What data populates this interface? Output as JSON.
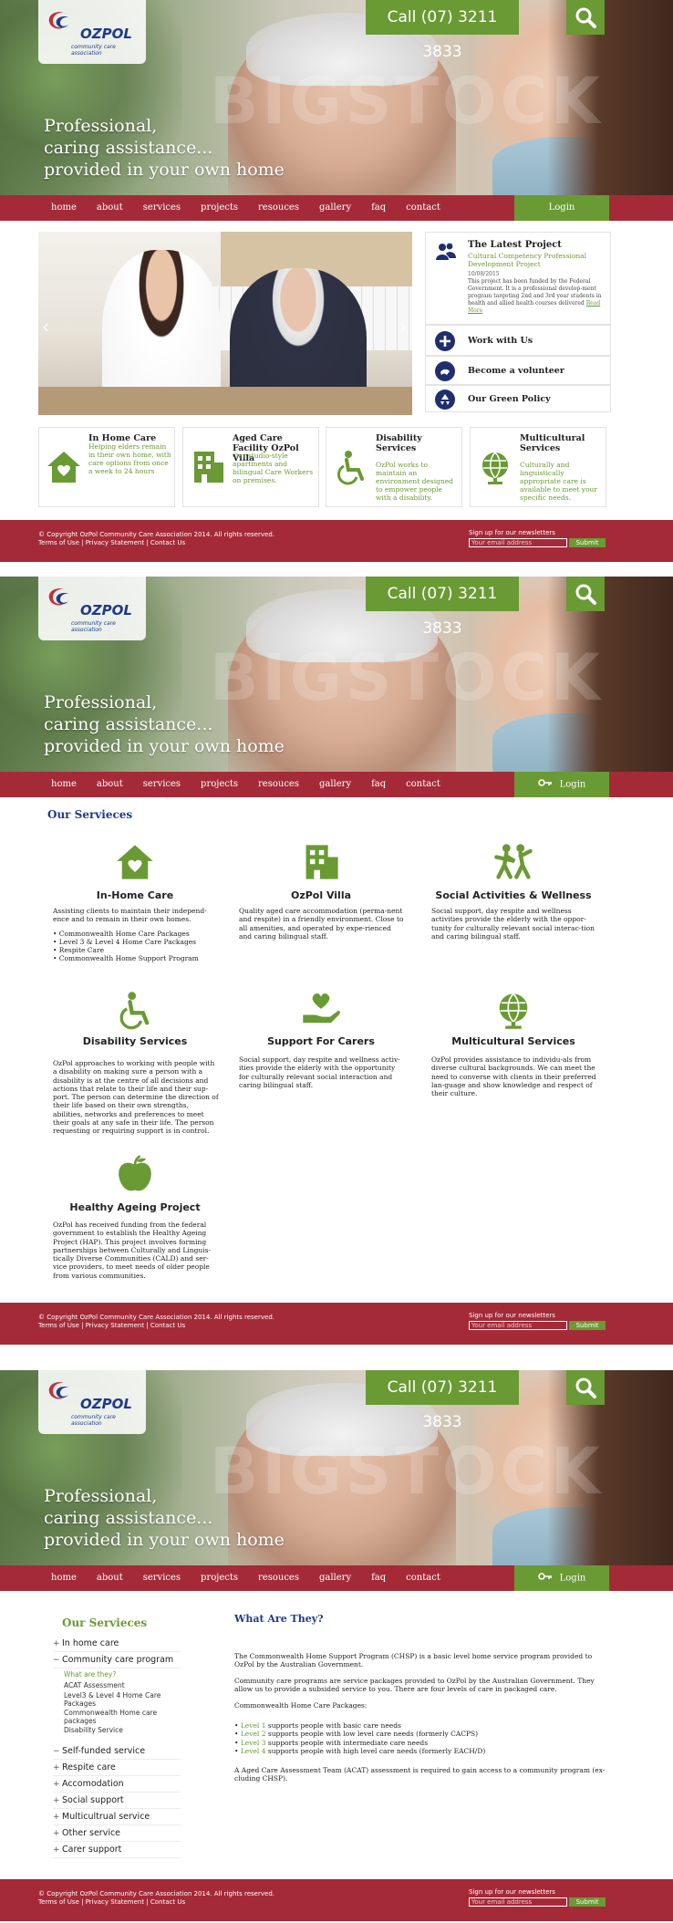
{
  "header": {
    "phone": "Call (07) 3211 3833",
    "logo_name": "OZPOL",
    "logo_tag": "community care association",
    "watermark": "BIGSTOCK",
    "tagline": [
      "Professional,",
      "caring assistance...",
      "provided in your own home"
    ]
  },
  "nav": {
    "items": [
      "home",
      "about",
      "services",
      "projects",
      "resouces",
      "gallery",
      "faq",
      "contact"
    ],
    "login": "Login"
  },
  "footer": {
    "copyright": "© Copyright OzPol Community Care Association 2014. All rights reserved.",
    "links": "Terms of Use | Privacy Statement | Contact Us",
    "newsletter": "Sign up for our newsletters",
    "email_placeholder": "Your email address",
    "submit": "Submit"
  },
  "home": {
    "latest": {
      "title": "The Latest Project",
      "subtitle": "Cultural Competency Professional Development Project",
      "date": "10/08/2015",
      "description": "This project has been funded by the Federal Government. It is a professional develop-ment program targeting 2nd and 3rd year students in health and allied health courses delivered",
      "read_more": "Read More"
    },
    "side_links": [
      "Work with Us",
      "Become a volunteer",
      "Our Green Policy"
    ],
    "features": [
      {
        "title": "In Home Care",
        "text": "Helping elders remain in their own home, with care options from once a week to 24 hours"
      },
      {
        "title": "Aged Care Facility OzPol Villa",
        "text": "Our studio-style apartments and bilingual Care Workers on premises."
      },
      {
        "title": "Disability Services",
        "text": "OzPol works to maintain an environment designed to empower people with a disability."
      },
      {
        "title": "Multicultural Services",
        "text": "Culturally and linguistically appropriate care is available to meet your specific needs."
      }
    ]
  },
  "services": {
    "heading": "Our Servieces",
    "items": [
      {
        "title": "In-Home Care",
        "body": "Assisting clients to maintain their independ-ence and to remain in their own homes.",
        "bullets": [
          "• Commonwealth Home Care Packages",
          "• Level 3 & Level 4 Home Care Packages",
          "• Respite Care",
          "• Commonwealth Home Support Program"
        ]
      },
      {
        "title": "OzPol Villa",
        "body": "Quality aged care accommodation (perma-nent and respite) in a friendly environment. Close to all amenities, and operated by expe-rienced and caring bilingual staff."
      },
      {
        "title": "Social Activities & Wellness",
        "body": "Social support, day respite and wellness activities provide the elderly with the oppor-tunity for culturally relevant social interac-tion and caring bilingual staff."
      },
      {
        "title": "Disability Services",
        "body": "OzPol approaches to working with people with a disability on making sure a person with a disability is at the centre of all decisions and actions that relate to their life and their sup-port. The person can determine the direction of their life based on their own strengths, abilities, networks and preferences to meet their goals at any safe in their life. The person requesting or requiring support is in control."
      },
      {
        "title": "Support For Carers",
        "body": "Social support, day respite and wellness activ-ities provide the elderly with the opportunity for culturally relevant social interaction and caring bilingual staff."
      },
      {
        "title": "Multicultural Services",
        "body": "OzPol provides assistance to individu-als from diverse cultural backgrounds. We can meet the need to converse with clients in their preferred lan-guage and show knowledge and respect of their culture."
      },
      {
        "title": "Healthy Ageing Project",
        "body": "OzPol has received funding from the federal government to establish the Healthy Ageing Project (HAP). This project involves forming partnerships between Culturally and Linguis-tically Diverse Communities (CALD) and ser-vice providers, to meet needs of older people from various communities."
      }
    ]
  },
  "program": {
    "heading": "Our Servieces",
    "menu": [
      {
        "sign": "+",
        "label": "In home care"
      },
      {
        "sign": "−",
        "label": "Community care program"
      },
      {
        "sign": "−",
        "label": "Self-funded service"
      },
      {
        "sign": "+",
        "label": "Respite care"
      },
      {
        "sign": "+",
        "label": "Accomodation"
      },
      {
        "sign": "+",
        "label": "Social support"
      },
      {
        "sign": "+",
        "label": "Multicultrual service"
      },
      {
        "sign": "+",
        "label": "Other service"
      },
      {
        "sign": "+",
        "label": "Carer support"
      }
    ],
    "submenu": [
      "What are they?",
      "ACAT Assessment",
      "Level3 & Level 4 Home Care Packages",
      "Commonwealth Home care packages",
      "Disability Service"
    ],
    "title": "What Are They?",
    "p1": "The Commonwealth Home Support Program (CHSP) is a basic level home service program provided to OzPol by the Australian Government.",
    "p2": "Community care programs are service packages provided to OzPol by the Australian Government.  They allow us to provide a subsided service to you.  There are four levels of care in packaged care.",
    "p3": "Commonwealth Home Care Packages:",
    "levels": [
      {
        "lvl": "Level 1",
        "text": " supports people with basic care needs"
      },
      {
        "lvl": "Level 2",
        "text": " supports people with low level care needs (formerly CACPS)"
      },
      {
        "lvl": "Level 3",
        "text": " supports people with intermediate care needs"
      },
      {
        "lvl": "Level 4",
        "text": " supports people with high level care needs (formerly EACH/D)"
      }
    ],
    "p4": "A Aged Care Assessment Team (ACAT) assessment is required to gain access to a community program (ex-cluding CHSP)."
  },
  "colors": {
    "accent_green": "#6a9a34",
    "brand_red": "#a52a38",
    "navy": "#1f3a8a"
  }
}
